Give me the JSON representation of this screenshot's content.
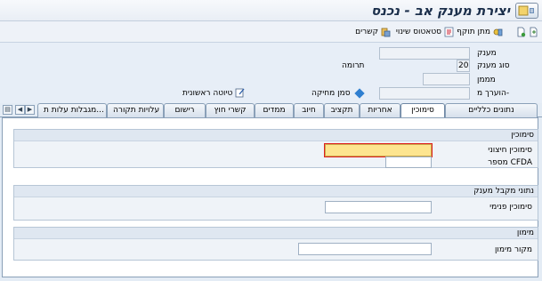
{
  "title": "יצירת מענק אב - נכנס",
  "toolbar": {
    "relations": "קשרים",
    "status_change": "סטאטוס שינוי",
    "valid_period": "מתן תוקף"
  },
  "header": {
    "grant_label": "מענק",
    "grant_value": "",
    "grant_type_label": "סוג מענק",
    "grant_type_value": "20",
    "grant_type_desc": "תרומה",
    "funder_label": "מממן",
    "funder_value": "",
    "submitted_to_label": "הוערך מ-",
    "submitted_to_value": "",
    "deletion_mark_label": "סמן מחיקה",
    "first_draft_label": "טיוטה ראשונית"
  },
  "tabs": [
    "נתונים כלליים",
    "סימוכין",
    "אחריות",
    "תקציב",
    "חיוב",
    "ממדים",
    "קשרי חוץ",
    "רישום",
    "עלויות תקורה",
    "מגבלות עלות ת..."
  ],
  "active_tab": "סימוכין",
  "groups": {
    "references": {
      "title": "סימוכין",
      "external_ref_label": "סימוכין חיצוני",
      "external_ref_value": "",
      "cfda_label": "מספר CFDA",
      "cfda_value": ""
    },
    "recipient": {
      "title": "נתוני מקבל מענק",
      "internal_ref_label": "סימוכין פנימי",
      "internal_ref_value": ""
    },
    "financing": {
      "title": "מימון",
      "source_label": "מקור מימון",
      "source_value": ""
    }
  },
  "icons": {
    "title": "sap-hat-icon",
    "relations": "relations-icon",
    "status": "status-icon",
    "valid": "valid-period-icon",
    "nav": "nav-icon"
  },
  "colors": {
    "selected_field": "#fde58f",
    "active_tab": "#ffffff",
    "background": "#e4ecf5"
  }
}
